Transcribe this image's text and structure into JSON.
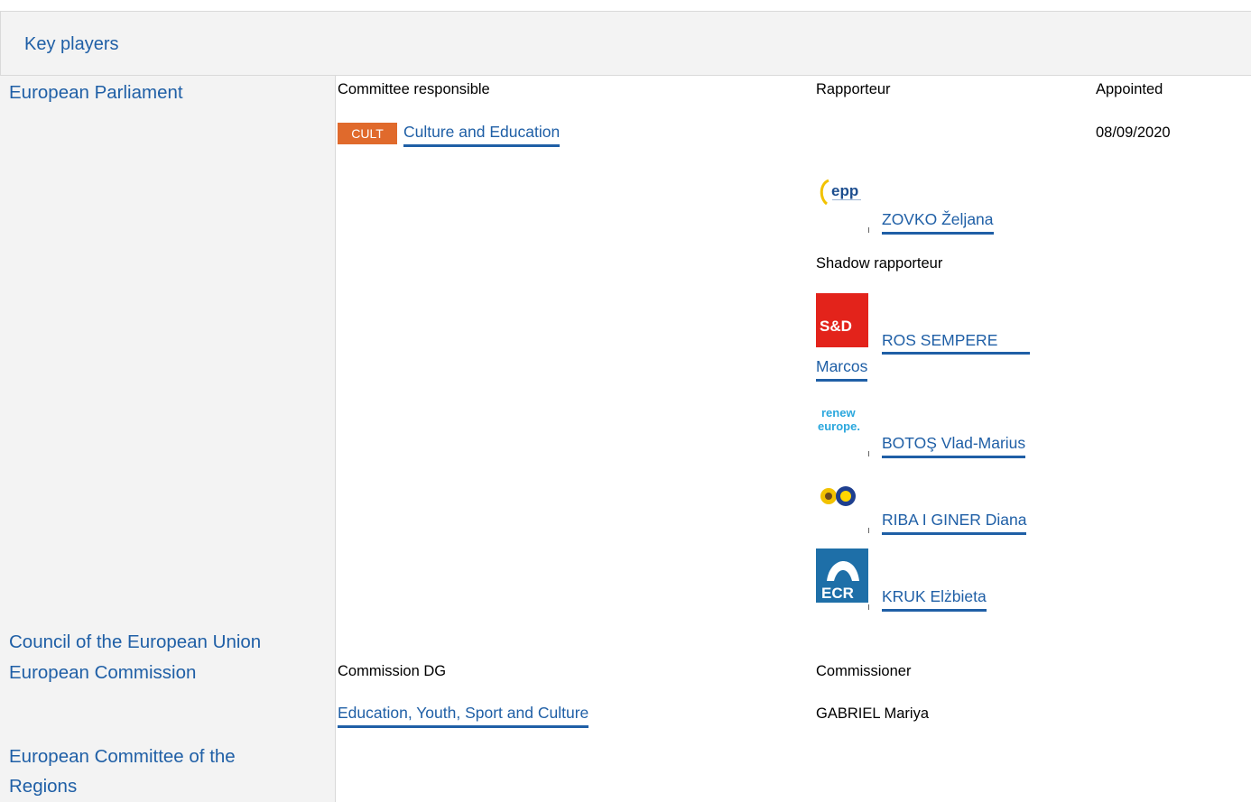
{
  "section": {
    "title": "Key players"
  },
  "bodies": {
    "ep": "European Parliament",
    "council": "Council of the European Union",
    "commission": "European Commission",
    "cor": "European Committee of the Regions"
  },
  "ep": {
    "committee_header": "Committee responsible",
    "rapporteur_header": "Rapporteur",
    "appointed_header": "Appointed",
    "committee_code": "CULT",
    "committee_name": "Culture and Education",
    "appointed_date": "08/09/2020",
    "rapporteur": {
      "name": "ZOVKO Željana",
      "group_icon": "epp-logo-icon"
    },
    "shadow_header": "Shadow rapporteur",
    "shadows": [
      {
        "name_line1": "ROS SEMPERE",
        "name_line2": "Marcos",
        "group_icon": "sd-logo-icon",
        "logo_text": "S&D"
      },
      {
        "name": "BOTOŞ Vlad-Marius",
        "group_icon": "renew-europe-logo-icon",
        "logo_line1": "renew",
        "logo_line2": "europe."
      },
      {
        "name": "RIBA I GINER Diana",
        "group_icon": "greens-efa-logo-icon"
      },
      {
        "name": "KRUK Elżbieta",
        "group_icon": "ecr-logo-icon",
        "logo_text": "ECR"
      }
    ],
    "epp_logo_text": "epp"
  },
  "commission": {
    "dg_header": "Commission DG",
    "commissioner_header": "Commissioner",
    "dg_name": "Education, Youth, Sport and Culture",
    "commissioner_name": "GABRIEL Mariya"
  },
  "colors": {
    "link": "#1f5fa6",
    "cult_badge": "#e06a2c",
    "sd_red": "#e3231b",
    "ecr_blue": "#1e6fa8",
    "panel_bg": "#f3f3f3"
  }
}
